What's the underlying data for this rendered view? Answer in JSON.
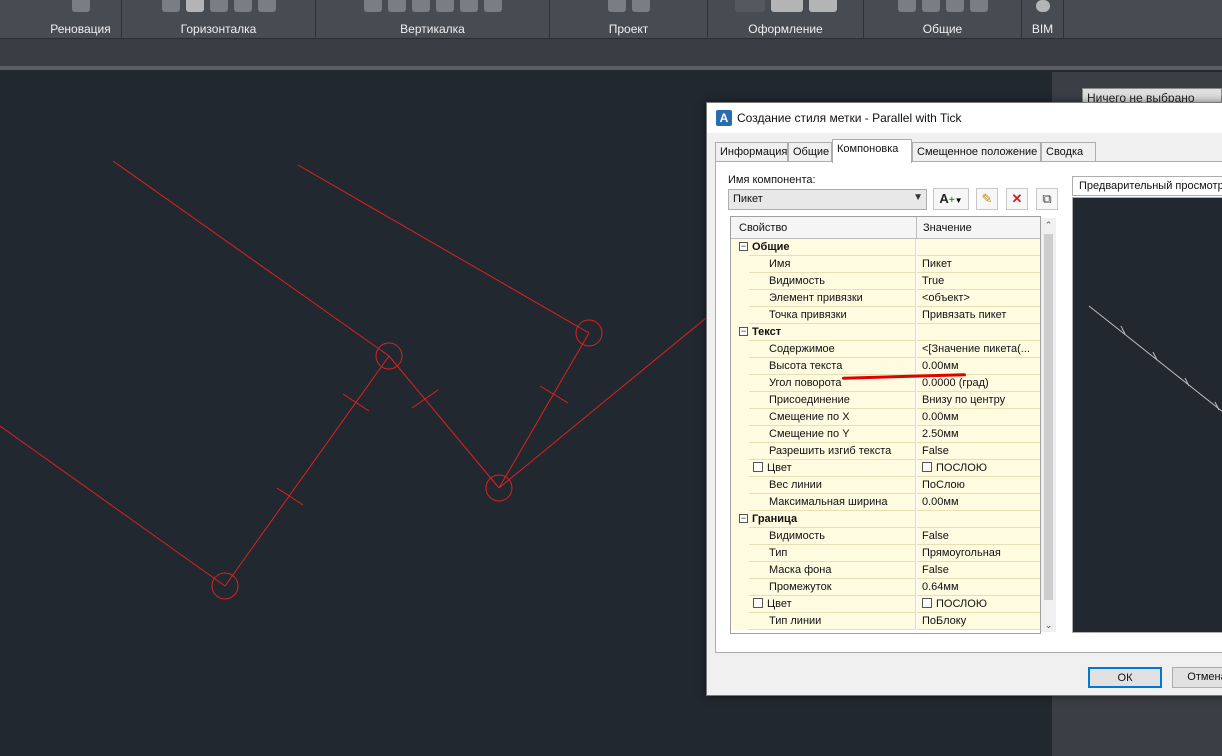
{
  "ribbon": {
    "groups": [
      "Реновация",
      "Горизонталка",
      "Вертикалка",
      "Проект",
      "Оформление",
      "Общие",
      "BIM"
    ]
  },
  "side_panel": {
    "combo_value": "Ничего не выбрано"
  },
  "dialog": {
    "title": "Создание стиля метки - Parallel with Tick",
    "tabs": [
      "Информация",
      "Общие",
      "Компоновка",
      "Смещенное положение",
      "Сводка"
    ],
    "active_tab": "Компоновка",
    "component_label": "Имя компонента:",
    "component_value": "Пикет",
    "grid": {
      "col_property": "Свойство",
      "col_value": "Значение",
      "categories": [
        {
          "name": "Общие",
          "rows": [
            {
              "name": "Имя",
              "value": "Пикет"
            },
            {
              "name": "Видимость",
              "value": "True"
            },
            {
              "name": "Элемент привязки",
              "value": "<объект>"
            },
            {
              "name": "Точка привязки",
              "value": "Привязать пикет"
            }
          ]
        },
        {
          "name": "Текст",
          "rows": [
            {
              "name": "Содержимое",
              "value": "<[Значение пикета(..."
            },
            {
              "name": "Высота текста",
              "value": "0.00мм"
            },
            {
              "name": "Угол поворота",
              "value": "0.0000 (град)"
            },
            {
              "name": "Присоединение",
              "value": "Внизу по центру"
            },
            {
              "name": "Смещение по X",
              "value": "0.00мм"
            },
            {
              "name": "Смещение по Y",
              "value": "2.50мм"
            },
            {
              "name": "Разрешить изгиб текста",
              "value": "False"
            },
            {
              "name": "Цвет",
              "value": "ПОСЛОЮ"
            },
            {
              "name": "Вес линии",
              "value": "ПоСлою"
            },
            {
              "name": "Максимальная ширина",
              "value": "0.00мм"
            }
          ]
        },
        {
          "name": "Граница",
          "rows": [
            {
              "name": "Видимость",
              "value": "False"
            },
            {
              "name": "Тип",
              "value": "Прямоугольная"
            },
            {
              "name": "Маска фона",
              "value": "False"
            },
            {
              "name": "Промежуток",
              "value": "0.64мм"
            },
            {
              "name": "Цвет",
              "value": "ПОСЛОЮ"
            },
            {
              "name": "Тип линии",
              "value": "ПоБлоку"
            }
          ]
        }
      ]
    },
    "preview_label": "Предварительный просмотр",
    "ok_label": "ОК",
    "cancel_label": "Отмена"
  },
  "colors": {
    "canvas_bg": "#212830",
    "drawing_red": "#e02020",
    "drawing_grey": "#bfbfbf",
    "highlight_underline": "#e00000"
  }
}
